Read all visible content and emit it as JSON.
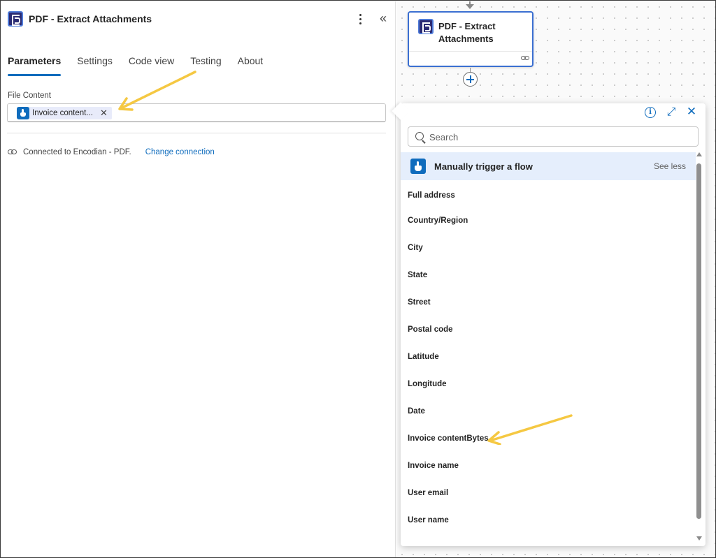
{
  "panel": {
    "title": "PDF - Extract Attachments",
    "tabs": [
      {
        "label": "Parameters",
        "active": true
      },
      {
        "label": "Settings"
      },
      {
        "label": "Code view"
      },
      {
        "label": "Testing"
      },
      {
        "label": "About"
      }
    ],
    "field": {
      "label": "File Content",
      "token_label": "Invoice content..."
    },
    "connection": {
      "text": "Connected to Encodian - PDF.",
      "change_label": "Change connection"
    }
  },
  "canvas": {
    "card_title": "PDF - Extract Attachments"
  },
  "flyout": {
    "search_placeholder": "Search",
    "section": {
      "title": "Manually trigger a flow",
      "toggle_label": "See less"
    },
    "items": [
      "Full address",
      "Country/Region",
      "City",
      "State",
      "Street",
      "Postal code",
      "Latitude",
      "Longitude",
      "Date",
      "Invoice contentBytes",
      "Invoice name",
      "User email",
      "User name"
    ]
  },
  "icons": {
    "app": "encodian-pdf-icon",
    "trigger": "manual-trigger-icon",
    "more": "more-vertical-icon",
    "collapse": "collapse-chevrons-icon",
    "link": "link-icon",
    "info": "info-icon",
    "expand": "expand-icon",
    "close": "close-icon",
    "search": "search-icon",
    "add": "add-step-icon"
  },
  "colors": {
    "accent": "#0f6cbd",
    "section_bg": "#e5eefc",
    "annotation_arrow": "#f5c842",
    "app_icon": "#2b2b73"
  }
}
